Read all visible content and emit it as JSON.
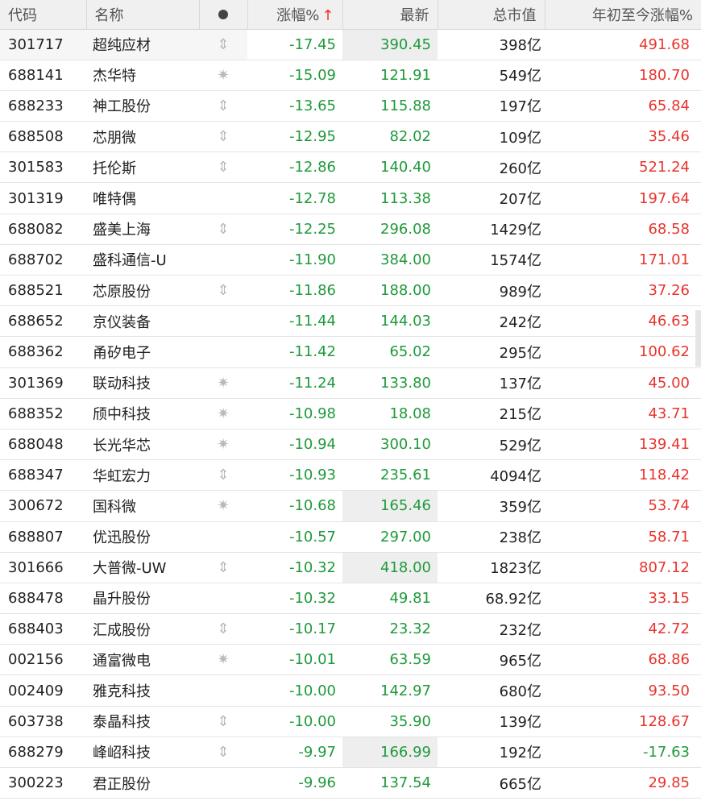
{
  "headers": {
    "code": "代码",
    "name": "名称",
    "change": "涨幅%",
    "change_sort_arrow": "↑",
    "price": "最新",
    "market_cap": "总市值",
    "ytd": "年初至今涨幅%"
  },
  "colors": {
    "up": "#e8342e",
    "down": "#1f9a3b"
  },
  "rows": [
    {
      "code": "301717",
      "name": "超纯应材",
      "mark": "⇕",
      "change": "-17.45",
      "price": "390.45",
      "cap": "398亿",
      "ytd": "491.68",
      "ytd_dir": "up",
      "price_hl": true
    },
    {
      "code": "688141",
      "name": "杰华特",
      "mark": "✷",
      "change": "-15.09",
      "price": "121.91",
      "cap": "549亿",
      "ytd": "180.70",
      "ytd_dir": "up",
      "price_hl": false
    },
    {
      "code": "688233",
      "name": "神工股份",
      "mark": "⇕",
      "change": "-13.65",
      "price": "115.88",
      "cap": "197亿",
      "ytd": "65.84",
      "ytd_dir": "up",
      "price_hl": false
    },
    {
      "code": "688508",
      "name": "芯朋微",
      "mark": "⇕",
      "change": "-12.95",
      "price": "82.02",
      "cap": "109亿",
      "ytd": "35.46",
      "ytd_dir": "up",
      "price_hl": false
    },
    {
      "code": "301583",
      "name": "托伦斯",
      "mark": "⇕",
      "change": "-12.86",
      "price": "140.40",
      "cap": "260亿",
      "ytd": "521.24",
      "ytd_dir": "up",
      "price_hl": false
    },
    {
      "code": "301319",
      "name": "唯特偶",
      "mark": "",
      "change": "-12.78",
      "price": "113.38",
      "cap": "207亿",
      "ytd": "197.64",
      "ytd_dir": "up",
      "price_hl": false
    },
    {
      "code": "688082",
      "name": "盛美上海",
      "mark": "⇕",
      "change": "-12.25",
      "price": "296.08",
      "cap": "1429亿",
      "ytd": "68.58",
      "ytd_dir": "up",
      "price_hl": false
    },
    {
      "code": "688702",
      "name": "盛科通信-U",
      "mark": "",
      "change": "-11.90",
      "price": "384.00",
      "cap": "1574亿",
      "ytd": "171.01",
      "ytd_dir": "up",
      "price_hl": false
    },
    {
      "code": "688521",
      "name": "芯原股份",
      "mark": "⇕",
      "change": "-11.86",
      "price": "188.00",
      "cap": "989亿",
      "ytd": "37.26",
      "ytd_dir": "up",
      "price_hl": false
    },
    {
      "code": "688652",
      "name": "京仪装备",
      "mark": "",
      "change": "-11.44",
      "price": "144.03",
      "cap": "242亿",
      "ytd": "46.63",
      "ytd_dir": "up",
      "price_hl": false
    },
    {
      "code": "688362",
      "name": "甬矽电子",
      "mark": "",
      "change": "-11.42",
      "price": "65.02",
      "cap": "295亿",
      "ytd": "100.62",
      "ytd_dir": "up",
      "price_hl": false
    },
    {
      "code": "301369",
      "name": "联动科技",
      "mark": "✷",
      "change": "-11.24",
      "price": "133.80",
      "cap": "137亿",
      "ytd": "45.00",
      "ytd_dir": "up",
      "price_hl": false
    },
    {
      "code": "688352",
      "name": "颀中科技",
      "mark": "✷",
      "change": "-10.98",
      "price": "18.08",
      "cap": "215亿",
      "ytd": "43.71",
      "ytd_dir": "up",
      "price_hl": false
    },
    {
      "code": "688048",
      "name": "长光华芯",
      "mark": "✷",
      "change": "-10.94",
      "price": "300.10",
      "cap": "529亿",
      "ytd": "139.41",
      "ytd_dir": "up",
      "price_hl": false
    },
    {
      "code": "688347",
      "name": "华虹宏力",
      "mark": "⇕",
      "change": "-10.93",
      "price": "235.61",
      "cap": "4094亿",
      "ytd": "118.42",
      "ytd_dir": "up",
      "price_hl": false
    },
    {
      "code": "300672",
      "name": "国科微",
      "mark": "✷",
      "change": "-10.68",
      "price": "165.46",
      "cap": "359亿",
      "ytd": "53.74",
      "ytd_dir": "up",
      "price_hl": true
    },
    {
      "code": "688807",
      "name": "优迅股份",
      "mark": "",
      "change": "-10.57",
      "price": "297.00",
      "cap": "238亿",
      "ytd": "58.71",
      "ytd_dir": "up",
      "price_hl": false
    },
    {
      "code": "301666",
      "name": "大普微-UW",
      "mark": "⇕",
      "change": "-10.32",
      "price": "418.00",
      "cap": "1823亿",
      "ytd": "807.12",
      "ytd_dir": "up",
      "price_hl": true
    },
    {
      "code": "688478",
      "name": "晶升股份",
      "mark": "",
      "change": "-10.32",
      "price": "49.81",
      "cap": "68.92亿",
      "ytd": "33.15",
      "ytd_dir": "up",
      "price_hl": false
    },
    {
      "code": "688403",
      "name": "汇成股份",
      "mark": "⇕",
      "change": "-10.17",
      "price": "23.32",
      "cap": "232亿",
      "ytd": "42.72",
      "ytd_dir": "up",
      "price_hl": false
    },
    {
      "code": "002156",
      "name": "通富微电",
      "mark": "✷",
      "change": "-10.01",
      "price": "63.59",
      "cap": "965亿",
      "ytd": "68.86",
      "ytd_dir": "up",
      "price_hl": false
    },
    {
      "code": "002409",
      "name": "雅克科技",
      "mark": "",
      "change": "-10.00",
      "price": "142.97",
      "cap": "680亿",
      "ytd": "93.50",
      "ytd_dir": "up",
      "price_hl": false
    },
    {
      "code": "603738",
      "name": "泰晶科技",
      "mark": "⇕",
      "change": "-10.00",
      "price": "35.90",
      "cap": "139亿",
      "ytd": "128.67",
      "ytd_dir": "up",
      "price_hl": false
    },
    {
      "code": "688279",
      "name": "峰岹科技",
      "mark": "⇕",
      "change": "-9.97",
      "price": "166.99",
      "cap": "192亿",
      "ytd": "-17.63",
      "ytd_dir": "down",
      "price_hl": true
    },
    {
      "code": "300223",
      "name": "君正股份",
      "mark": "",
      "change": "-9.96",
      "price": "137.54",
      "cap": "665亿",
      "ytd": "29.85",
      "ytd_dir": "up",
      "price_hl": false
    }
  ]
}
